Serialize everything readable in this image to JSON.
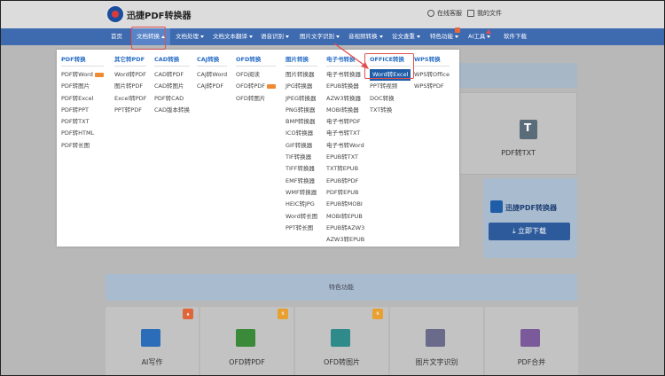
{
  "brand": "迅捷PDF转换器",
  "top_links": {
    "online_edit": "在线客服",
    "my_files": "我的文件"
  },
  "nav": [
    {
      "label": "首页",
      "caret": false
    },
    {
      "label": "文档转换",
      "caret": true,
      "active": true
    },
    {
      "label": "文档处理",
      "caret": true
    },
    {
      "label": "文档文本翻译",
      "caret": true
    },
    {
      "label": "语音识别",
      "caret": true
    },
    {
      "label": "图片文字识别",
      "caret": true
    },
    {
      "label": "音视频转换",
      "caret": true
    },
    {
      "label": "论文查重",
      "caret": true
    },
    {
      "label": "特色功能",
      "caret": true
    },
    {
      "label": "AI工具",
      "caret": true
    },
    {
      "label": "软件下载",
      "caret": false
    }
  ],
  "dropdown": {
    "columns": [
      {
        "header": "PDF转换",
        "items": [
          "PDF转Word",
          "PDF转图片",
          "PDF转Excel",
          "PDF转PPT",
          "PDF转TXT",
          "PDF转HTML",
          "PDF转长图"
        ],
        "new_on": 0
      },
      {
        "header": "其它转PDF",
        "items": [
          "Word转PDF",
          "图片转PDF",
          "Excel转PDF",
          "PPT转PDF"
        ]
      },
      {
        "header": "CAD转换",
        "items": [
          "CAD转PDF",
          "CAD转图片",
          "PDF转CAD",
          "CAD版本转换"
        ]
      },
      {
        "header": "CAJ转换",
        "items": [
          "CAJ转Word",
          "CAJ转PDF"
        ]
      },
      {
        "header": "OFD转换",
        "items": [
          "OFD阅读",
          "OFD转PDF",
          "OFD转图片"
        ],
        "new_on": 1
      },
      {
        "header": "图片转换",
        "items": [
          "图片转换器",
          "JPG转换器",
          "JPEG转换器",
          "PNG转换器",
          "BMP转换器",
          "ICO转换器",
          "GIF转换器",
          "TIF转换器",
          "TIFF转换器",
          "EMF转换器",
          "WMF转换器",
          "HEIC转JPG",
          "Word转长图",
          "PPT转长图"
        ]
      },
      {
        "header": "电子书转换",
        "items": [
          "电子书转换器",
          "EPUB转换器",
          "AZW3转换器",
          "MOBI转换器",
          "电子书转PDF",
          "电子书转TXT",
          "电子书转Word",
          "EPUB转TXT",
          "TXT转EPUB",
          "EPUB转PDF",
          "PDF转EPUB",
          "EPUB转MOBI",
          "MOBI转EPUB",
          "EPUB转AZW3",
          "AZW3转EPUB"
        ]
      },
      {
        "header": "OFFICE转换",
        "items": [
          "Word转Excel",
          "PPT转视频",
          "DOC转换",
          "TXT转换"
        ],
        "selected": 0
      },
      {
        "header": "WPS转换",
        "items": [
          "WPS转Office",
          "WPS转PDF"
        ]
      }
    ]
  },
  "background": {
    "txt_card": "PDF转TXT",
    "txt_icon": "T",
    "promo_title": "迅捷PDF转换器",
    "promo_button": "立即下载",
    "feature_title": "特色功能",
    "features": [
      {
        "label": "AI写作",
        "color": "#2b6db8",
        "badge": "hot"
      },
      {
        "label": "OFD转PDF",
        "color": "#3a8a3a",
        "badge": "new"
      },
      {
        "label": "OFD转图片",
        "color": "#2f8a8a",
        "badge": "new"
      },
      {
        "label": "图片文字识别",
        "color": "#6a6a8a",
        "badge": ""
      },
      {
        "label": "PDF合并",
        "color": "#7a5a9a",
        "badge": ""
      }
    ]
  },
  "colors": {
    "nav_bg": "#3e6ab0",
    "accent": "#2a6fc6",
    "highlight_border": "#e05050",
    "selected_bg": "#1f5da8"
  }
}
